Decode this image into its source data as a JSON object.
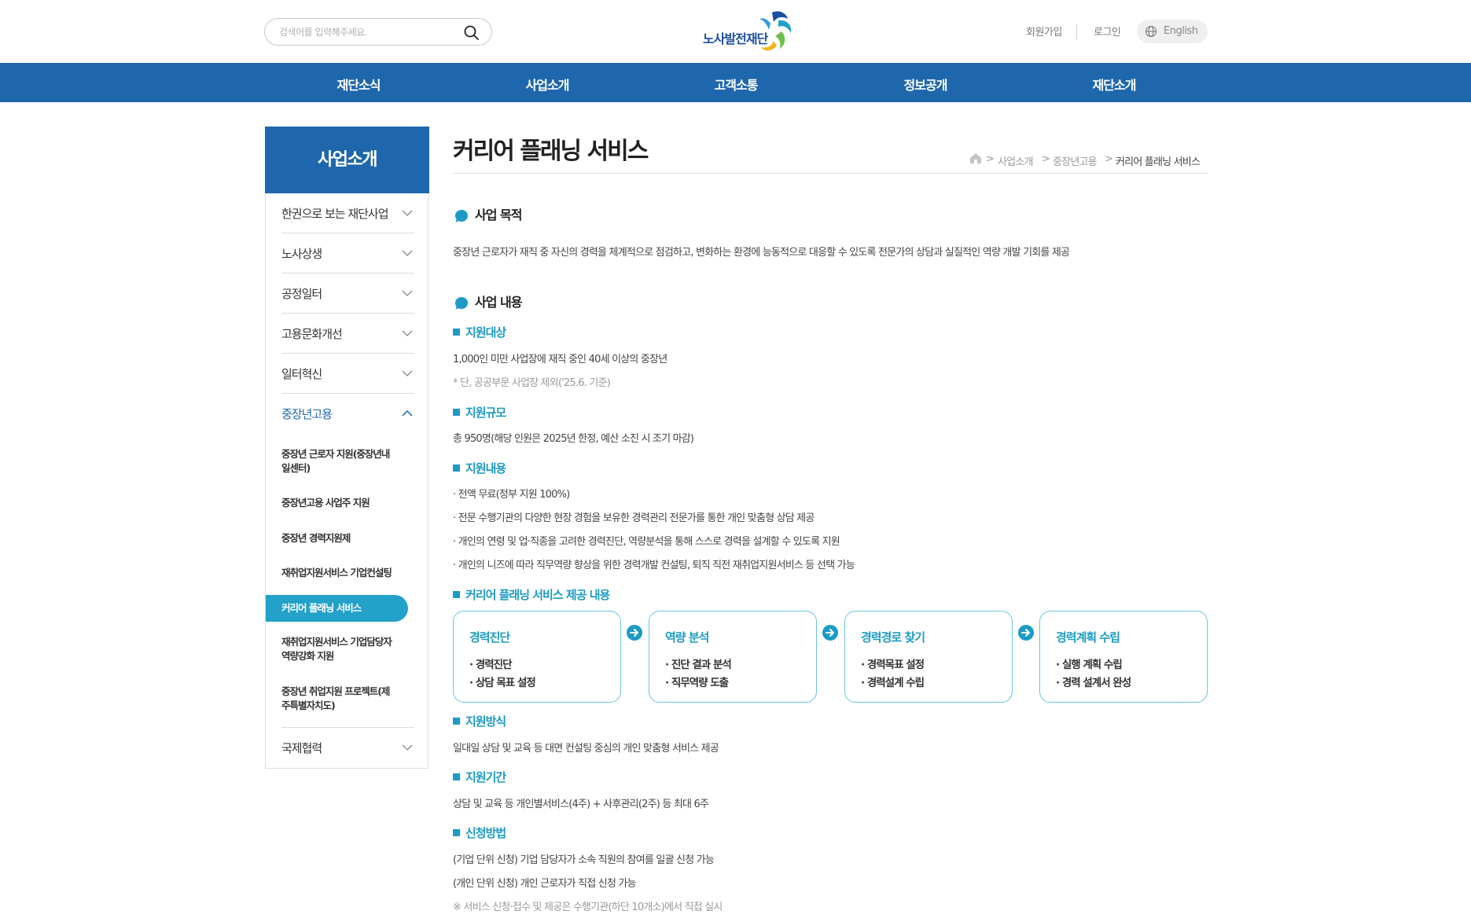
{
  "header": {
    "search_placeholder": "검색어를 입력해주세요.",
    "logo_text": "노사발전재단",
    "join_label": "회원가입",
    "login_label": "로그인",
    "lang_label": "English"
  },
  "gnb": {
    "items": [
      {
        "label": "재단소식"
      },
      {
        "label": "사업소개"
      },
      {
        "label": "고객소통"
      },
      {
        "label": "정보공개"
      },
      {
        "label": "재단소개"
      }
    ]
  },
  "sidebar": {
    "title": "사업소개",
    "items": [
      {
        "label": "한권으로 보는 재단사업"
      },
      {
        "label": "노사상생"
      },
      {
        "label": "공정일터"
      },
      {
        "label": "고용문화개선"
      },
      {
        "label": "일터혁신"
      },
      {
        "label": "중장년고용"
      },
      {
        "label": "국제협력"
      }
    ],
    "subitems": [
      {
        "label_1": "중장년 근로자 지원(중장년내",
        "label_2": "일센터)"
      },
      {
        "label_1": "중장년고용 사업주 지원"
      },
      {
        "label_1": "중장년 경력지원제"
      },
      {
        "label_1": "재취업지원서비스 기업컨설팅"
      },
      {
        "label_1": "커리어 플래닝 서비스"
      },
      {
        "label_1": "재취업지원서비스 기업담당자",
        "label_2": "역량강화 지원"
      },
      {
        "label_1": "중장년 취업지원 프로젝트(제",
        "label_2": "주특별자치도)"
      }
    ]
  },
  "page": {
    "title": "커리어 플래닝 서비스",
    "breadcrumb": [
      "사업소개",
      "중장년고용",
      "커리어 플래닝 서비스"
    ],
    "purpose_heading": "사업 목적",
    "purpose_text": "중장년 근로자가 재직 중 자신의 경력을 체계적으로 점검하고, 변화하는 환경에 능동적으로 대응할 수 있도록 전문가의 상담과 실질적인 역량 개발 기회를 제공",
    "content_heading": "사업 내용",
    "target_heading": "지원대상",
    "target_text": "1,000인 미만 사업장에 재직 중인 40세 이상의 중장년",
    "target_note": "* 단, 공공부문 사업장 제외('25.6. 기준)",
    "scale_heading": "지원규모",
    "scale_text": "총 950명(해당 인원은 2025년 한정, 예산 소진 시 조기 마감)",
    "details_heading": "지원내용",
    "details": [
      "· 전액 무료(정부 지원 100%)",
      "· 전문 수행기관의 다양한 현장 경험을 보유한 경력관리 전문가를 통한 개인 맞춤형 상담 제공",
      "· 개인의 연령 및 업·직종을 고려한 경력진단, 역량분석을 통해 스스로 경력을 설계할 수 있도록 지원",
      "· 개인의 니즈에 따라 직무역량 향상을 위한 경력개발 컨설팅, 퇴직 직전 재취업지원서비스 등 선택 가능"
    ],
    "service_heading": "커리어 플래닝 서비스 제공 내용",
    "steps": [
      {
        "title": "경력진단",
        "items": [
          "· 경력진단",
          "· 상담 목표 설정"
        ]
      },
      {
        "title": "역량 분석",
        "items": [
          "· 진단 결과 분석",
          "· 직무역량 도출"
        ]
      },
      {
        "title": "경력경로 찾기",
        "items": [
          "· 경력목표 설정",
          "· 경력설계 수립"
        ]
      },
      {
        "title": "경력계획 수립",
        "items": [
          "· 실행 계획 수립",
          "· 경력 설계서 완성"
        ]
      }
    ],
    "method_heading": "지원방식",
    "method_text": "일대일 상담 및 교육 등 대면 컨설팅 중심의 개인 맞춤형 서비스 제공",
    "period_heading": "지원기간",
    "period_text": "상담 및 교육 등 개인별서비스(4주) + 사후관리(2주) 등 최대 6주",
    "apply_heading": "신청방법",
    "apply_texts": [
      "(기업 단위 신청) 기업 담당자가 소속 직원의 참여를 일괄 신청 가능",
      "(개인 단위 신청) 개인 근로자가 직접 신청 가능"
    ],
    "apply_note": "※ 서비스 신청·접수 및 제공은 수행기관(하단 10개소)에서 직접 실시"
  },
  "colors": {
    "brand_blue": "#1f67ad",
    "accent_cyan": "#1e9bc5",
    "active_sub": "#22a1c9"
  }
}
